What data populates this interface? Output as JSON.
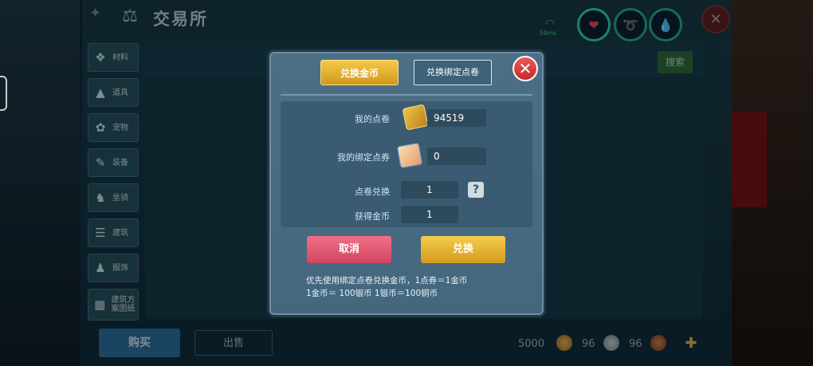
{
  "header": {
    "title": "交易所"
  },
  "sidebar": {
    "items": [
      {
        "label": "材料",
        "icon": "materials-icon"
      },
      {
        "label": "道具",
        "icon": "props-icon"
      },
      {
        "label": "宠物",
        "icon": "pet-icon"
      },
      {
        "label": "装备",
        "icon": "equipment-icon"
      },
      {
        "label": "坐骑",
        "icon": "mount-icon"
      },
      {
        "label": "建筑",
        "icon": "building-icon"
      },
      {
        "label": "服饰",
        "icon": "clothing-icon"
      },
      {
        "label": "建筑方案图纸",
        "icon": "blueprint-icon"
      }
    ]
  },
  "search": {
    "button_label": "搜索"
  },
  "bottom": {
    "buy_label": "购买",
    "sell_label": "出售",
    "gold": "5000",
    "silver": "96",
    "copper": "96"
  },
  "hud": {
    "ping": "34ms"
  },
  "dialog": {
    "tab_active": "兑换金币",
    "tab_inactive": "兑换绑定点卷",
    "my_points_label": "我的点卷",
    "my_points_value": "94519",
    "my_bound_label": "我的绑定点券",
    "my_bound_value": "0",
    "exchange_label": "点卷兑换",
    "exchange_value": "1",
    "gain_label": "获得金币",
    "gain_value": "1",
    "help_symbol": "?",
    "cancel_label": "取消",
    "confirm_label": "兑换",
    "note_line1": "优先使用绑定点卷兑换金币，1点券＝1金币",
    "note_line2": "1金币＝ 100银币  1银币＝100铜币"
  },
  "colors": {
    "gold_button": "#e6b633",
    "cancel_button": "#e05a72",
    "dialog_bg": "#4a6c83"
  }
}
